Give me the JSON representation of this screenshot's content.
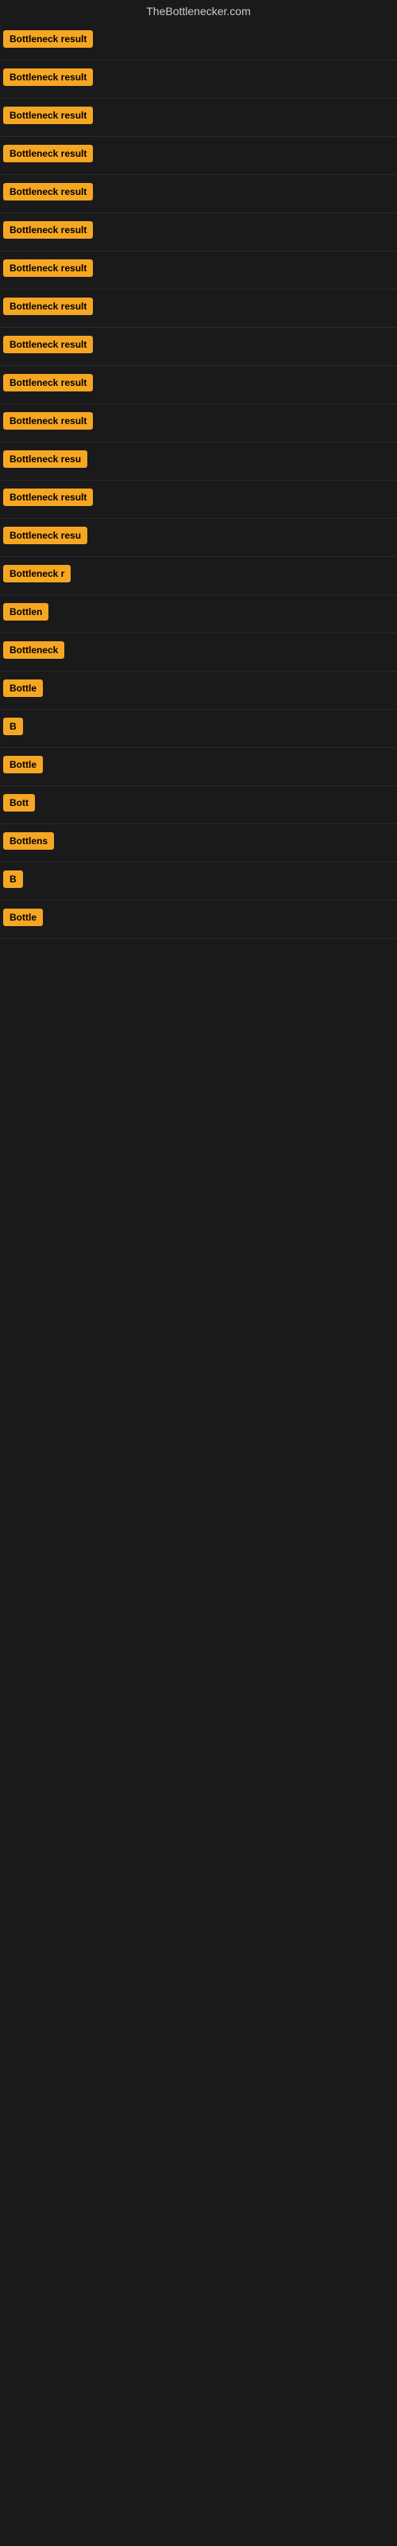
{
  "site": {
    "title": "TheBottlenecker.com"
  },
  "rows": [
    {
      "id": 1,
      "label": "Bottleneck result",
      "visible_text": "Bottleneck result"
    },
    {
      "id": 2,
      "label": "Bottleneck result",
      "visible_text": "Bottleneck result"
    },
    {
      "id": 3,
      "label": "Bottleneck result",
      "visible_text": "Bottleneck result"
    },
    {
      "id": 4,
      "label": "Bottleneck result",
      "visible_text": "Bottleneck result"
    },
    {
      "id": 5,
      "label": "Bottleneck result",
      "visible_text": "Bottleneck result"
    },
    {
      "id": 6,
      "label": "Bottleneck result",
      "visible_text": "Bottleneck result"
    },
    {
      "id": 7,
      "label": "Bottleneck result",
      "visible_text": "Bottleneck result"
    },
    {
      "id": 8,
      "label": "Bottleneck result",
      "visible_text": "Bottleneck result"
    },
    {
      "id": 9,
      "label": "Bottleneck result",
      "visible_text": "Bottleneck result"
    },
    {
      "id": 10,
      "label": "Bottleneck result",
      "visible_text": "Bottleneck result"
    },
    {
      "id": 11,
      "label": "Bottleneck result",
      "visible_text": "Bottleneck result"
    },
    {
      "id": 12,
      "label": "Bottleneck resu",
      "visible_text": "Bottleneck resu"
    },
    {
      "id": 13,
      "label": "Bottleneck result",
      "visible_text": "Bottleneck result"
    },
    {
      "id": 14,
      "label": "Bottleneck resu",
      "visible_text": "Bottleneck resu"
    },
    {
      "id": 15,
      "label": "Bottleneck r",
      "visible_text": "Bottleneck r"
    },
    {
      "id": 16,
      "label": "Bottlen",
      "visible_text": "Bottlen"
    },
    {
      "id": 17,
      "label": "Bottleneck",
      "visible_text": "Bottleneck"
    },
    {
      "id": 18,
      "label": "Bottle",
      "visible_text": "Bottle"
    },
    {
      "id": 19,
      "label": "B",
      "visible_text": "B"
    },
    {
      "id": 20,
      "label": "Bottle",
      "visible_text": "Bottle"
    },
    {
      "id": 21,
      "label": "Bott",
      "visible_text": "Bott"
    },
    {
      "id": 22,
      "label": "Bottlens",
      "visible_text": "Bottlens"
    },
    {
      "id": 23,
      "label": "B",
      "visible_text": "B"
    },
    {
      "id": 24,
      "label": "Bottle",
      "visible_text": "Bottle"
    }
  ],
  "colors": {
    "badge_bg": "#f5a623",
    "badge_text": "#000000",
    "background": "#1a1a1a",
    "site_title": "#cccccc"
  }
}
